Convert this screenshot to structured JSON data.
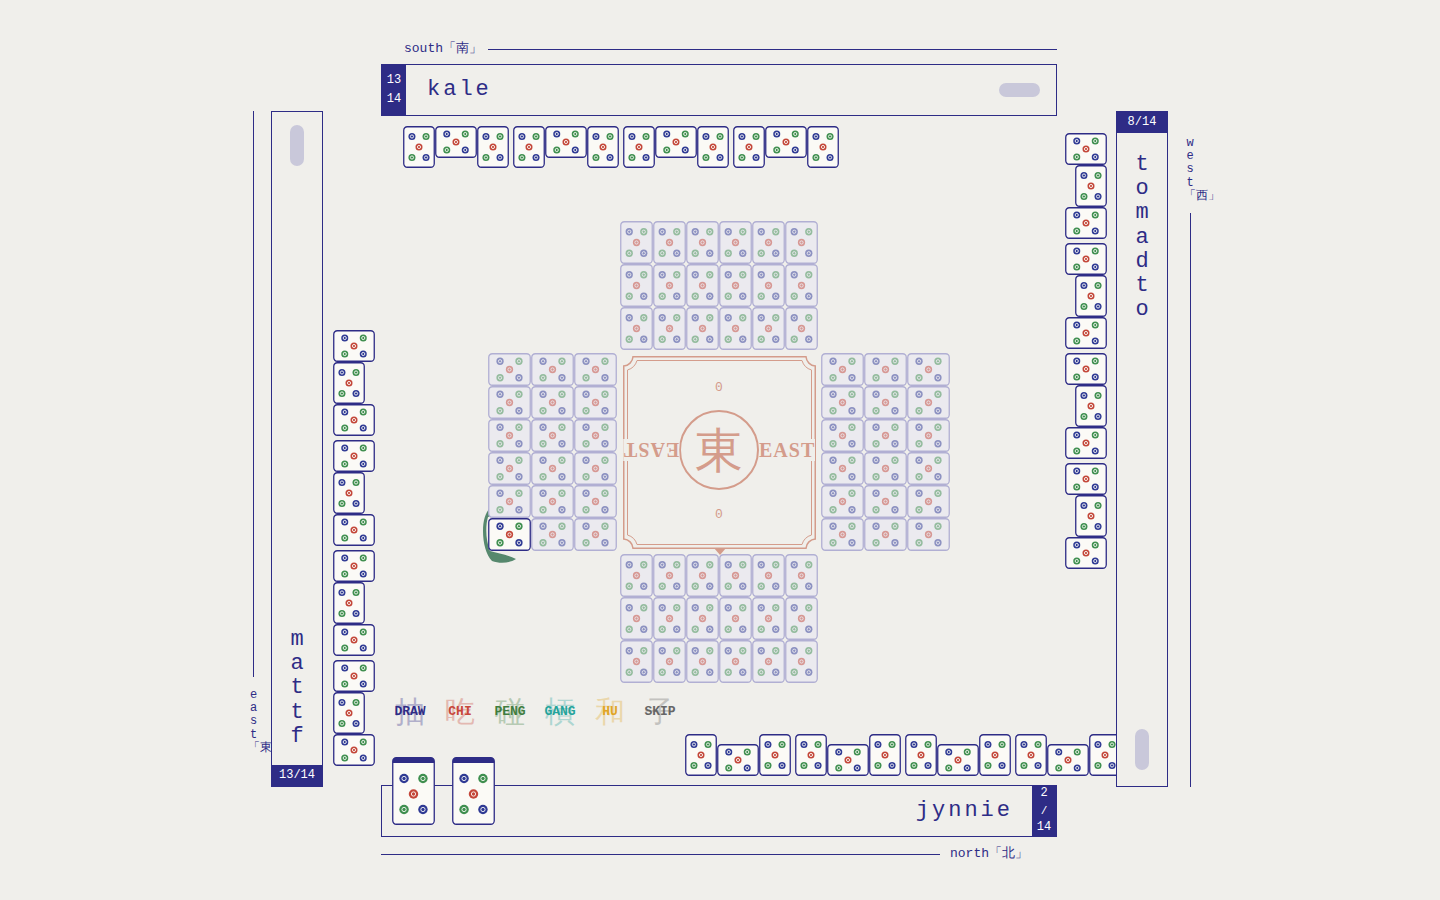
{
  "players": [
    {
      "name": "kale",
      "seat_label": "south「南」",
      "count": "13",
      "total": "14",
      "counter_kind": "stacked",
      "indicator": true,
      "melds": [
        {
          "tiles": [
            {
              "kind": "upright"
            },
            {
              "kind": "sideways"
            },
            {
              "kind": "upright"
            }
          ]
        },
        {
          "tiles": [
            {
              "kind": "upright"
            },
            {
              "kind": "sideways"
            },
            {
              "kind": "upright"
            }
          ]
        },
        {
          "tiles": [
            {
              "kind": "upright"
            },
            {
              "kind": "sideways"
            },
            {
              "kind": "upright"
            }
          ]
        },
        {
          "tiles": [
            {
              "kind": "upright"
            },
            {
              "kind": "sideways"
            },
            {
              "kind": "upright"
            }
          ]
        }
      ]
    },
    {
      "name": "mattf",
      "seat_label": "east「東」",
      "count": "13",
      "separator": "/",
      "total": "14",
      "counter_kind": "inline",
      "indicator": true,
      "melds": [
        {
          "tiles": [
            {
              "kind": "upright"
            },
            {
              "kind": "sideways"
            },
            {
              "kind": "upright"
            }
          ]
        },
        {
          "tiles": [
            {
              "kind": "upright"
            },
            {
              "kind": "sideways"
            },
            {
              "kind": "upright"
            }
          ]
        },
        {
          "tiles": [
            {
              "kind": "upright"
            },
            {
              "kind": "sideways"
            },
            {
              "kind": "upright"
            }
          ]
        },
        {
          "tiles": [
            {
              "kind": "upright"
            },
            {
              "kind": "sideways"
            },
            {
              "kind": "upright"
            }
          ]
        }
      ]
    },
    {
      "name": "tomadto",
      "seat_label": "west「西」",
      "count": "8",
      "separator": "/",
      "total": "14",
      "counter_kind": "inline",
      "indicator": true,
      "melds": [
        {
          "tiles": [
            {
              "kind": "upright"
            },
            {
              "kind": "sideways"
            },
            {
              "kind": "upright"
            }
          ]
        },
        {
          "tiles": [
            {
              "kind": "upright"
            },
            {
              "kind": "sideways"
            },
            {
              "kind": "upright"
            }
          ]
        },
        {
          "tiles": [
            {
              "kind": "upright"
            },
            {
              "kind": "sideways"
            },
            {
              "kind": "upright"
            }
          ]
        },
        {
          "tiles": [
            {
              "kind": "upright"
            },
            {
              "kind": "sideways"
            },
            {
              "kind": "upright"
            }
          ]
        }
      ]
    },
    {
      "name": "jynnie",
      "seat_label": "north「北」",
      "count": "2",
      "separator": "/",
      "total": "14",
      "counter_kind": "stacked",
      "indicator": false,
      "melds": [
        {
          "tiles": [
            {
              "kind": "upright"
            },
            {
              "kind": "sideways"
            },
            {
              "kind": "upright"
            }
          ]
        },
        {
          "tiles": [
            {
              "kind": "upright"
            },
            {
              "kind": "sideways"
            },
            {
              "kind": "upright"
            }
          ]
        },
        {
          "tiles": [
            {
              "kind": "upright"
            },
            {
              "kind": "sideways"
            },
            {
              "kind": "upright"
            }
          ]
        },
        {
          "tiles": [
            {
              "kind": "upright"
            },
            {
              "kind": "sideways"
            },
            {
              "kind": "upright"
            }
          ]
        }
      ],
      "concealed": [
        {
          "face_up": true
        },
        {
          "face_up": true
        }
      ]
    }
  ],
  "wall": [
    {
      "kind": "upright",
      "tiles": [
        {
          "highlighted": false
        },
        {
          "highlighted": false
        },
        {
          "highlighted": false
        },
        {
          "highlighted": false
        },
        {
          "highlighted": false
        },
        {
          "highlighted": false
        },
        {
          "highlighted": false
        },
        {
          "highlighted": false
        },
        {
          "highlighted": false
        },
        {
          "highlighted": false
        },
        {
          "highlighted": false
        },
        {
          "highlighted": false
        },
        {
          "highlighted": false
        },
        {
          "highlighted": false
        },
        {
          "highlighted": false
        },
        {
          "highlighted": false
        },
        {
          "highlighted": false
        },
        {
          "highlighted": false
        }
      ]
    },
    {
      "kind": "sideways",
      "tiles": [
        {
          "highlighted": false
        },
        {
          "highlighted": false
        },
        {
          "highlighted": false
        },
        {
          "highlighted": false
        },
        {
          "highlighted": false
        },
        {
          "highlighted": false
        },
        {
          "highlighted": false
        },
        {
          "highlighted": false
        },
        {
          "highlighted": false
        },
        {
          "highlighted": false
        },
        {
          "highlighted": false
        },
        {
          "highlighted": false
        },
        {
          "highlighted": false
        },
        {
          "highlighted": false
        },
        {
          "highlighted": false
        },
        {
          "highlighted": true
        },
        {
          "highlighted": false
        },
        {
          "highlighted": false
        }
      ]
    },
    {
      "kind": "sideways",
      "tiles": [
        {
          "highlighted": false
        },
        {
          "highlighted": false
        },
        {
          "highlighted": false
        },
        {
          "highlighted": false
        },
        {
          "highlighted": false
        },
        {
          "highlighted": false
        },
        {
          "highlighted": false
        },
        {
          "highlighted": false
        },
        {
          "highlighted": false
        },
        {
          "highlighted": false
        },
        {
          "highlighted": false
        },
        {
          "highlighted": false
        },
        {
          "highlighted": false
        },
        {
          "highlighted": false
        },
        {
          "highlighted": false
        },
        {
          "highlighted": false
        },
        {
          "highlighted": false
        },
        {
          "highlighted": false
        }
      ]
    },
    {
      "kind": "upright",
      "tiles": [
        {
          "highlighted": false
        },
        {
          "highlighted": false
        },
        {
          "highlighted": false
        },
        {
          "highlighted": false
        },
        {
          "highlighted": false
        },
        {
          "highlighted": false
        },
        {
          "highlighted": false
        },
        {
          "highlighted": false
        },
        {
          "highlighted": false
        },
        {
          "highlighted": false
        },
        {
          "highlighted": false
        },
        {
          "highlighted": false
        },
        {
          "highlighted": false
        },
        {
          "highlighted": false
        },
        {
          "highlighted": false
        },
        {
          "highlighted": false
        },
        {
          "highlighted": false
        },
        {
          "highlighted": false
        }
      ]
    }
  ],
  "center": {
    "wind": "東",
    "labels": [
      "EAST",
      "EAST"
    ],
    "counters": [
      "0",
      "0"
    ],
    "pointer": "down"
  },
  "actions": [
    {
      "glyph": "抽",
      "label": "DRAW",
      "color": "#2e2c86"
    },
    {
      "glyph": "吃",
      "label": "CHI",
      "color": "#c8473a"
    },
    {
      "glyph": "碰",
      "label": "PENG",
      "color": "#3f7d3f"
    },
    {
      "glyph": "槓",
      "label": "GANG",
      "color": "#24a39b"
    },
    {
      "glyph": "和",
      "label": "HU",
      "color": "#e0a526"
    },
    {
      "glyph": "子",
      "label": "SKIP",
      "color": "#666666"
    }
  ]
}
